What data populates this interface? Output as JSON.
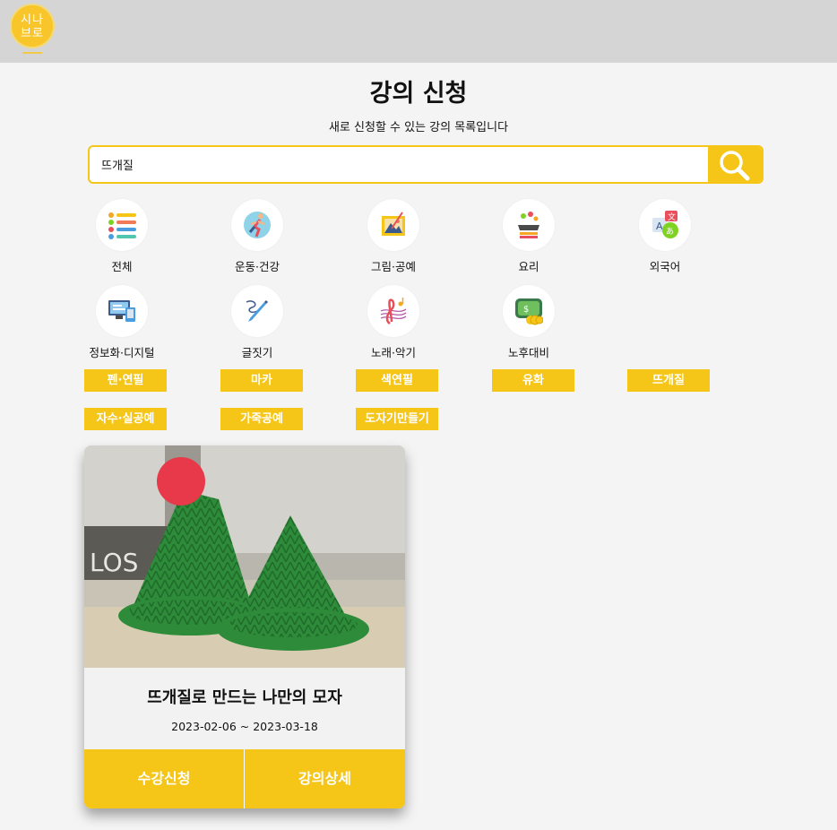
{
  "header": {
    "logo_line1": "시나",
    "logo_line2": "브로"
  },
  "page": {
    "title": "강의 신청",
    "subtitle": "새로 신청할 수 있는 강의 목록입니다"
  },
  "search": {
    "value": "뜨개질",
    "icon": "search-icon"
  },
  "categories": [
    {
      "label": "전체",
      "icon": "list-icon"
    },
    {
      "label": "운동·건강",
      "icon": "running-icon"
    },
    {
      "label": "그림·공예",
      "icon": "painting-icon"
    },
    {
      "label": "요리",
      "icon": "cooking-icon"
    },
    {
      "label": "외국어",
      "icon": "translate-icon"
    },
    {
      "label": "정보화·디지털",
      "icon": "computer-icon"
    },
    {
      "label": "글짓기",
      "icon": "pen-icon"
    },
    {
      "label": "노래·악기",
      "icon": "music-icon"
    },
    {
      "label": "노후대비",
      "icon": "money-icon"
    }
  ],
  "subcategories": [
    "펜·연필",
    "마카",
    "색연필",
    "유화",
    "뜨개질",
    "자수·실공예",
    "가죽공예",
    "도자기만들기"
  ],
  "course": {
    "title": "뜨개질로 만드는 나만의 모자",
    "dates": "2023-02-06 ~ 2023-03-18",
    "apply_label": "수강신청",
    "detail_label": "강의상세"
  },
  "colors": {
    "accent": "#f5c518",
    "header_bg": "#d5d5d5",
    "page_bg": "#f4f4f4"
  }
}
